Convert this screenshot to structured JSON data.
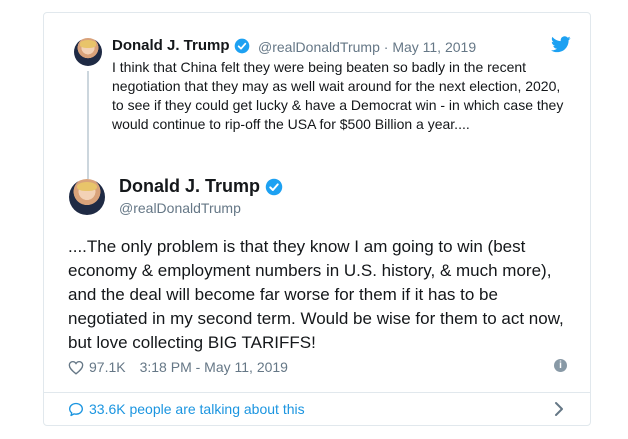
{
  "parent_tweet": {
    "name": "Donald J. Trump",
    "handle": "@realDonaldTrump",
    "separator": " · ",
    "date": "May 11, 2019",
    "text": "I think that China felt they were being beaten so badly in the recent negotiation that they may as well wait around for the next election, 2020, to see if they could get lucky & have a Democrat win - in which case they would continue to rip-off the USA for $500 Billion a year...."
  },
  "main_tweet": {
    "name": "Donald J. Trump",
    "handle": "@realDonaldTrump",
    "text": "....The only problem is that they know I am going to win (best economy & employment numbers in U.S. history, & much more), and the deal will become far worse for them if it has to be negotiated in my second term. Would be wise for them to act now, but love collecting BIG TARIFFS!",
    "likes": "97.1K",
    "timestamp": "3:18 PM - May 11, 2019"
  },
  "talking": {
    "text": "33.6K people are talking about this"
  },
  "icons": {
    "twitter": "twitter-bird-icon",
    "verified": "verified-badge-icon",
    "heart": "heart-icon",
    "info": "info-icon",
    "bubble": "chat-bubble-icon",
    "chevron": "chevron-right-icon"
  },
  "colors": {
    "accent": "#1da1f2",
    "link": "#1b95e0",
    "muted": "#657786",
    "border": "#e1e8ed"
  }
}
